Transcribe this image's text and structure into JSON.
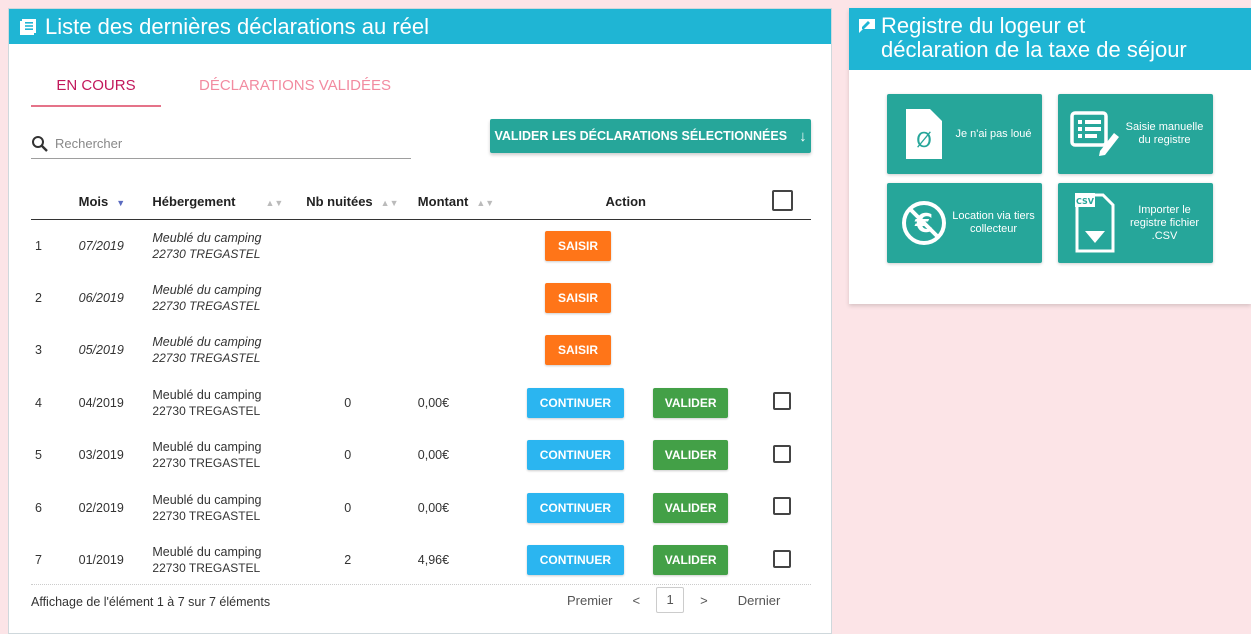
{
  "left_panel": {
    "title": "Liste des dernières déclarations au réel",
    "tabs": [
      {
        "label": "EN COURS",
        "active": true
      },
      {
        "label": "DÉCLARATIONS VALIDÉES",
        "active": false
      }
    ],
    "search": {
      "placeholder": "Rechercher"
    },
    "bulk_button": {
      "label": "VALIDER LES DÉCLARATIONS SÉLECTIONNÉES"
    },
    "table": {
      "headers": {
        "mois": "Mois",
        "hebergement": "Hébergement",
        "nuitees": "Nb nuitées",
        "montant": "Montant",
        "action": "Action"
      },
      "rows": [
        {
          "num": "1",
          "mois": "07/2019",
          "heb1": "Meublé du camping",
          "heb2": "22730 TREGASTEL",
          "nuitees": "",
          "montant": "",
          "action": "SAISIR"
        },
        {
          "num": "2",
          "mois": "06/2019",
          "heb1": "Meublé du camping",
          "heb2": "22730 TREGASTEL",
          "nuitees": "",
          "montant": "",
          "action": "SAISIR"
        },
        {
          "num": "3",
          "mois": "05/2019",
          "heb1": "Meublé du camping",
          "heb2": "22730 TREGASTEL",
          "nuitees": "",
          "montant": "",
          "action": "SAISIR"
        },
        {
          "num": "4",
          "mois": "04/2019",
          "heb1": "Meublé du camping",
          "heb2": "22730 TREGASTEL",
          "nuitees": "0",
          "montant": "0,00€",
          "action": "CONTINUER",
          "action2": "VALIDER"
        },
        {
          "num": "5",
          "mois": "03/2019",
          "heb1": "Meublé du camping",
          "heb2": "22730 TREGASTEL",
          "nuitees": "0",
          "montant": "0,00€",
          "action": "CONTINUER",
          "action2": "VALIDER"
        },
        {
          "num": "6",
          "mois": "02/2019",
          "heb1": "Meublé du camping",
          "heb2": "22730 TREGASTEL",
          "nuitees": "0",
          "montant": "0,00€",
          "action": "CONTINUER",
          "action2": "VALIDER"
        },
        {
          "num": "7",
          "mois": "01/2019",
          "heb1": "Meublé du camping",
          "heb2": "22730 TREGASTEL",
          "nuitees": "2",
          "montant": "4,96€",
          "action": "CONTINUER",
          "action2": "VALIDER"
        }
      ]
    },
    "footer": {
      "info": "Affichage de l'élément 1 à 7 sur 7 éléments",
      "first": "Premier",
      "prev": "<",
      "page": "1",
      "next": ">",
      "last": "Dernier"
    }
  },
  "right_panel": {
    "title_line1": "Registre du logeur et",
    "title_line2": "déclaration de la taxe de séjour",
    "tiles": [
      {
        "label": "Je n'ai pas loué",
        "icon": "empty-file-icon"
      },
      {
        "label": "Saisie manuelle du registre",
        "icon": "edit-list-icon"
      },
      {
        "label": "Location via tiers collecteur",
        "icon": "euro-circle-icon"
      },
      {
        "label": "Importer le registre fichier .CSV",
        "icon": "csv-file-icon"
      }
    ]
  },
  "colors": {
    "header": "#1fb5d4",
    "teal": "#26a69a",
    "orange": "#ff7518",
    "blue": "#2bb5f0",
    "green": "#43a047",
    "background": "#fce4e7"
  }
}
